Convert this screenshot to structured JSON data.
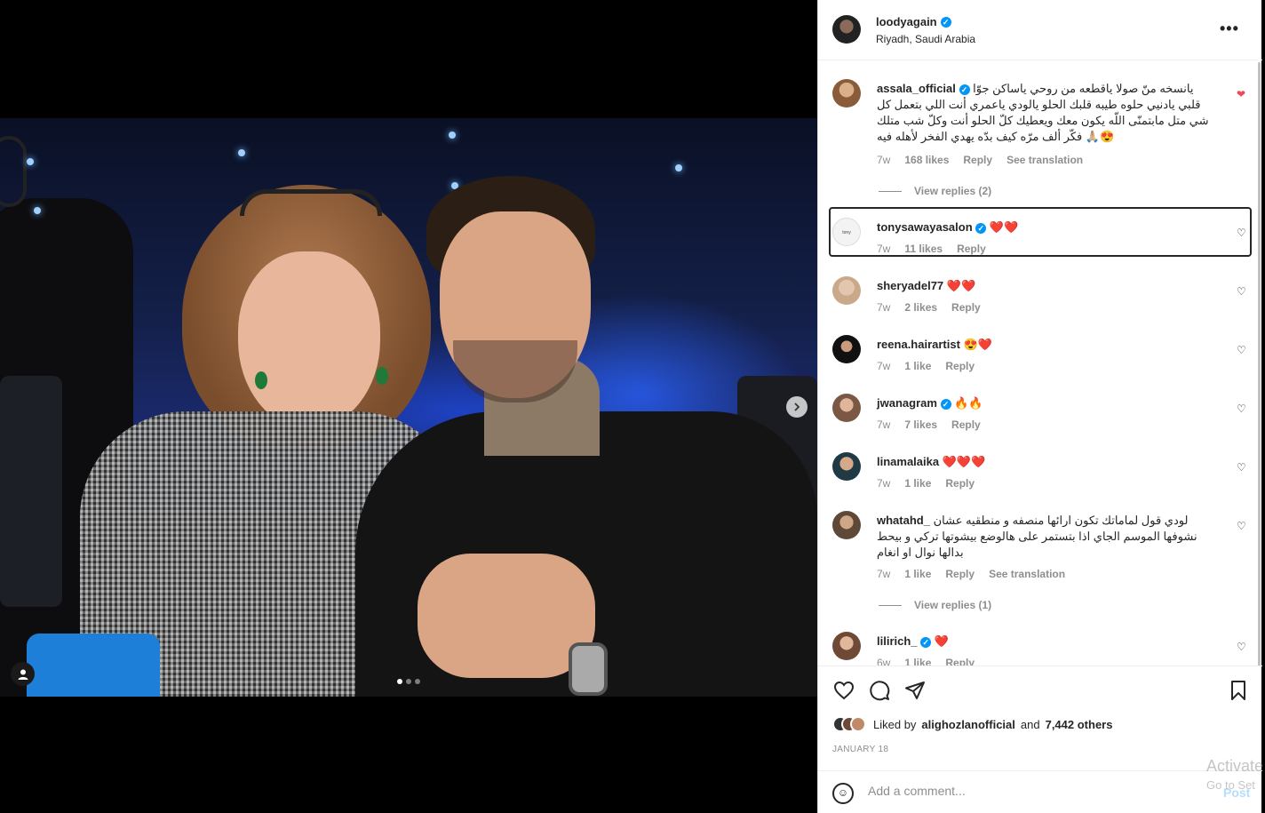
{
  "post": {
    "username": "loodyagain",
    "location": "Riyadh, Saudi Arabia",
    "more_icon": "more-horizontal-icon"
  },
  "comments": [
    {
      "username": "assala_official",
      "verified": true,
      "text": "يانسخه منّ صولا ياقطعه من روحي ياساكن جوّا قلبي يادنيي حلوه طيبه قلبك الحلو يالودي ياعمري أنت اللي بتعمل كل شي متل مابتمنّى اللّه يكون معك ويعطيك كلّ الحلو أنت وكلّ شب متلك فكّر ألف مرّه كيف بدّه يهدي الفخر لأهله فيه 🙏🏼😍",
      "time": "7w",
      "likes": "168 likes",
      "reply": "Reply",
      "translation": "See translation",
      "view_replies": "View replies (2)",
      "liked": true
    },
    {
      "username": "tonysawayasalon",
      "verified": true,
      "text": "❤️❤️",
      "time": "7w",
      "likes": "11 likes",
      "reply": "Reply"
    },
    {
      "username": "sheryadel77",
      "verified": false,
      "text": "❤️❤️",
      "time": "7w",
      "likes": "2 likes",
      "reply": "Reply"
    },
    {
      "username": "reena.hairartist",
      "verified": false,
      "text": "😍❤️",
      "time": "7w",
      "likes": "1 like",
      "reply": "Reply"
    },
    {
      "username": "jwanagram",
      "verified": true,
      "text": "🔥🔥",
      "time": "7w",
      "likes": "7 likes",
      "reply": "Reply"
    },
    {
      "username": "linamalaika",
      "verified": false,
      "text": "❤️❤️❤️",
      "time": "7w",
      "likes": "1 like",
      "reply": "Reply"
    },
    {
      "username": "whatahd_",
      "verified": false,
      "text": "لودي قول لماماتك تكون ارائها منصفه و منطقيه عشان نشوفها الموسم الجاي اذا بتستمر على هالوضع بيشوتها تركي و بيحط بدالها نوال او انغام",
      "time": "7w",
      "likes": "1 like",
      "reply": "Reply",
      "translation": "See translation",
      "view_replies": "View replies (1)"
    },
    {
      "username": "lilirich_",
      "verified": true,
      "text": "❤️",
      "time": "6w",
      "likes": "1 like",
      "reply": "Reply"
    }
  ],
  "actions": {
    "liked_by_prefix": "Liked by",
    "liked_by_user": "alighozlanofficial",
    "liked_by_and": "and",
    "liked_by_others": "7,442 others",
    "date": "JANUARY 18",
    "add_comment_placeholder": "Add a comment...",
    "post_label": "Post"
  },
  "media": {
    "carousel_count": 3,
    "carousel_active": 0
  },
  "watermark": {
    "line1": "Activate",
    "line2": "Go to Set"
  },
  "colors": {
    "verified": "#0095f6",
    "heart": "#ed4956",
    "post_btn_disabled": "#b2dffc"
  }
}
